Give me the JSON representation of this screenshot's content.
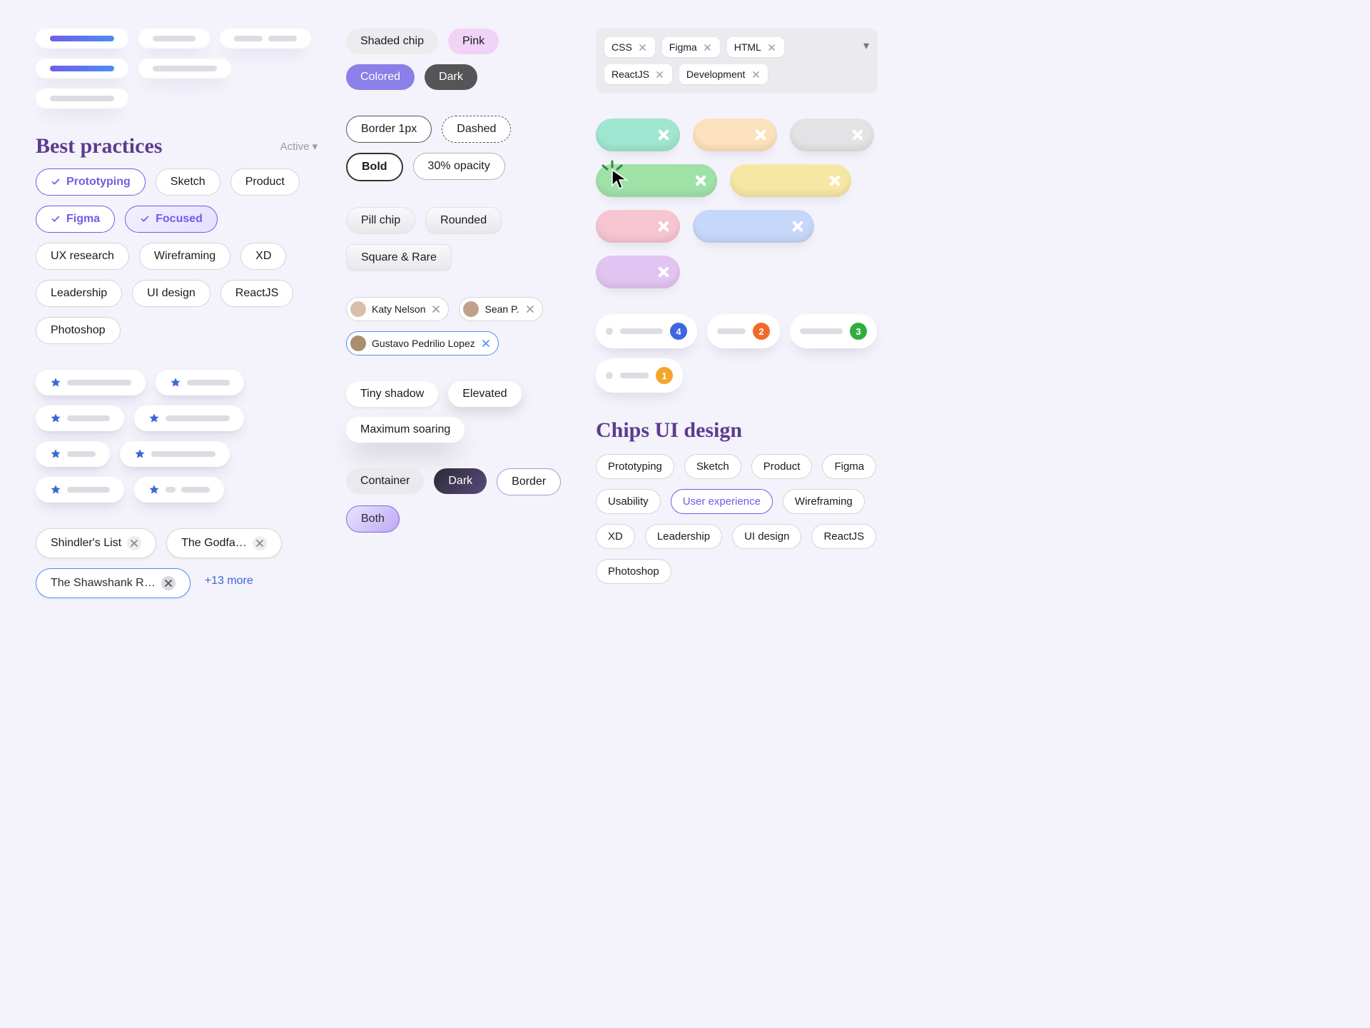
{
  "col1": {
    "heading": "Best practices",
    "dropdown": "Active",
    "tags": [
      "Prototyping",
      "Sketch",
      "Product",
      "Figma",
      "Focused",
      "UX research",
      "Wireframing",
      "XD",
      "Leadership",
      "UI design",
      "ReactJS",
      "Photoshop"
    ],
    "movies": {
      "items": [
        "Shindler's List",
        "The Godfa…",
        "The Shawshank R…"
      ],
      "more": "+13 more"
    }
  },
  "col2": {
    "fills": [
      "Shaded chip",
      "Pink",
      "Colored",
      "Dark"
    ],
    "borders": [
      "Border 1px",
      "Dashed",
      "Bold",
      "30% opacity"
    ],
    "shapes": [
      "Pill chip",
      "Rounded",
      "Square & Rare"
    ],
    "people": [
      "Katy Nelson",
      "Sean P.",
      "Gustavo Pedrilio Lopez"
    ],
    "shadows": [
      "Tiny shadow",
      "Elevated",
      "Maximum soaring"
    ],
    "combo": [
      "Container",
      "Dark",
      "Border",
      "Both"
    ]
  },
  "col3": {
    "tagbox": [
      "CSS",
      "Figma",
      "HTML",
      "ReactJS",
      "Development"
    ],
    "badges": [
      "4",
      "2",
      "3",
      "1"
    ],
    "heading": "Chips UI design",
    "tags": [
      "Prototyping",
      "Sketch",
      "Product",
      "Figma",
      "Usability",
      "User experience",
      "Wireframing",
      "XD",
      "Leadership",
      "UI design",
      "ReactJS",
      "Photoshop"
    ]
  }
}
